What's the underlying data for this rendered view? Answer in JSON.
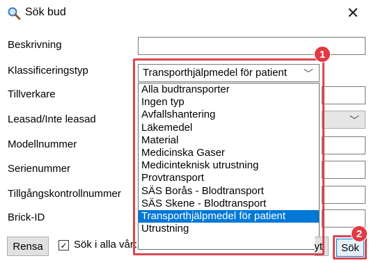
{
  "window": {
    "title": "Sök bud",
    "icon": "search-icon",
    "close_label": "✕"
  },
  "labels": {
    "beskrivning": "Beskrivning",
    "klassificeringstyp": "Klassificeringstyp",
    "tillverkare": "Tillverkare",
    "leasad": "Leasad/Inte leasad",
    "modellnummer": "Modellnummer",
    "serienummer": "Serienummer",
    "tillgangskontroll": "Tillgångskontrollnummer",
    "brick": "Brick-ID"
  },
  "classification": {
    "selected": "Transporthjälpmedel för patient",
    "options": [
      "Alla budtransporter",
      "Ingen typ",
      "Avfallshantering",
      "Läkemedel",
      "Material",
      "Medicinska Gaser",
      "Medicinteknisk utrustning",
      "Provtransport",
      "SÄS Borås - Blodtransport",
      "SÄS Skene - Blodtransport",
      "Transporthjälpmedel för patient",
      "Utrustning"
    ]
  },
  "footer": {
    "rensa": "Rensa",
    "checkbox_label": "Sök i alla vårdinrättningar",
    "checkbox_checked": true,
    "avbryt": "Avbryt",
    "sok": "Sök"
  },
  "annotations": {
    "badge1": "1",
    "badge2": "2",
    "color": "#e03a44"
  }
}
